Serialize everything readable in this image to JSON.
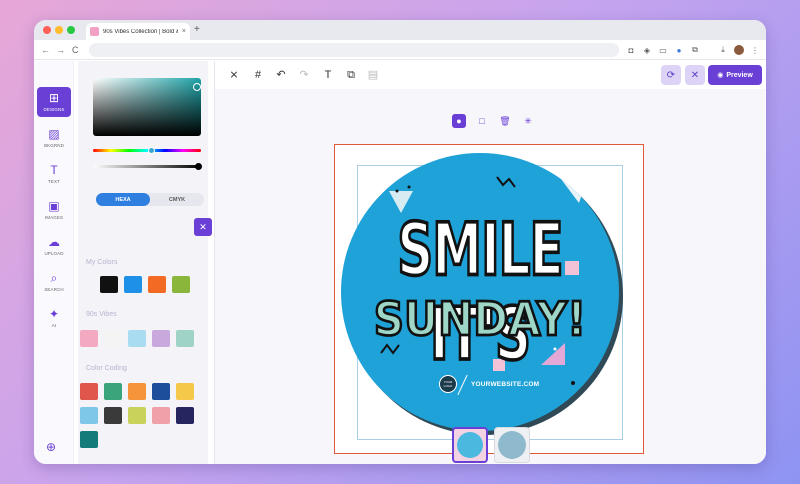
{
  "browser": {
    "tab_title": "90s Vibes Collection | Bold &",
    "tab_close": "×",
    "new_tab": "+",
    "nav_back": "←",
    "nav_forward": "→",
    "nav_reload": "C",
    "nav_home": "⌂"
  },
  "sidebar": {
    "items": [
      {
        "label": "DESIGNS",
        "icon": "plus-square-icon",
        "glyph": "⊞"
      },
      {
        "label": "BKGRND",
        "icon": "stripes-icon",
        "glyph": "▨"
      },
      {
        "label": "TEXT",
        "icon": "text-icon",
        "glyph": "T"
      },
      {
        "label": "IMAGES",
        "icon": "image-icon",
        "glyph": "▣"
      },
      {
        "label": "UPLOAD",
        "icon": "upload-cloud-icon",
        "glyph": "☁"
      },
      {
        "label": "SEARCH",
        "icon": "search-icon",
        "glyph": "⌕"
      },
      {
        "label": "AI",
        "icon": "sparkle-icon",
        "glyph": "✦"
      }
    ],
    "zoom_glyph": "⊕"
  },
  "color_panel": {
    "mode_hexa": "HEXA",
    "mode_cmyk": "CMYK",
    "cancel_glyph": "✕",
    "save_glyph": "▣",
    "my_colors_title": "My Colors",
    "my_colors": [
      "#111111",
      "#1e90e8",
      "#f26a24",
      "#8ab63c"
    ],
    "vibes_title": "90s Vibes",
    "vibes_colors": [
      "#f2a9c1",
      "#f4f4f4",
      "#a9dcf0",
      "#c9a8dd",
      "#9fd3c8"
    ],
    "coding_title": "Color Coding",
    "coding_colors": [
      "#e0564a",
      "#3aa57a",
      "#f5943a",
      "#1d4e9c",
      "#f5c84a",
      "#7fc7e8",
      "#3a3a3a",
      "#c7d35a",
      "#f0a0a8",
      "#262560",
      "#157a7a"
    ]
  },
  "toolbar": {
    "tools": [
      {
        "name": "crop-icon",
        "glyph": "⨯"
      },
      {
        "name": "grid-icon",
        "glyph": "#"
      },
      {
        "name": "undo-icon",
        "glyph": "↶"
      },
      {
        "name": "redo-icon",
        "glyph": "↷"
      },
      {
        "name": "text-tool-icon",
        "glyph": "T"
      },
      {
        "name": "layers-icon",
        "glyph": "⧉"
      },
      {
        "name": "paste-icon",
        "glyph": "▤"
      }
    ],
    "refresh_glyph": "⟳",
    "close_glyph": "✕",
    "preview_label": "Preview",
    "preview_glyph": "◉",
    "mini_tools": [
      {
        "name": "fill-icon",
        "glyph": "●"
      },
      {
        "name": "square-icon",
        "glyph": "□"
      },
      {
        "name": "trash-icon",
        "glyph": "🗑"
      },
      {
        "name": "spinner-icon",
        "glyph": "✳"
      }
    ]
  },
  "design": {
    "headline_line1": "SMILE IT'S",
    "headline_line2": "SUNDAY!",
    "logo_text": "YOUR LOGO",
    "website": "YOURWEBSITE.COM"
  }
}
